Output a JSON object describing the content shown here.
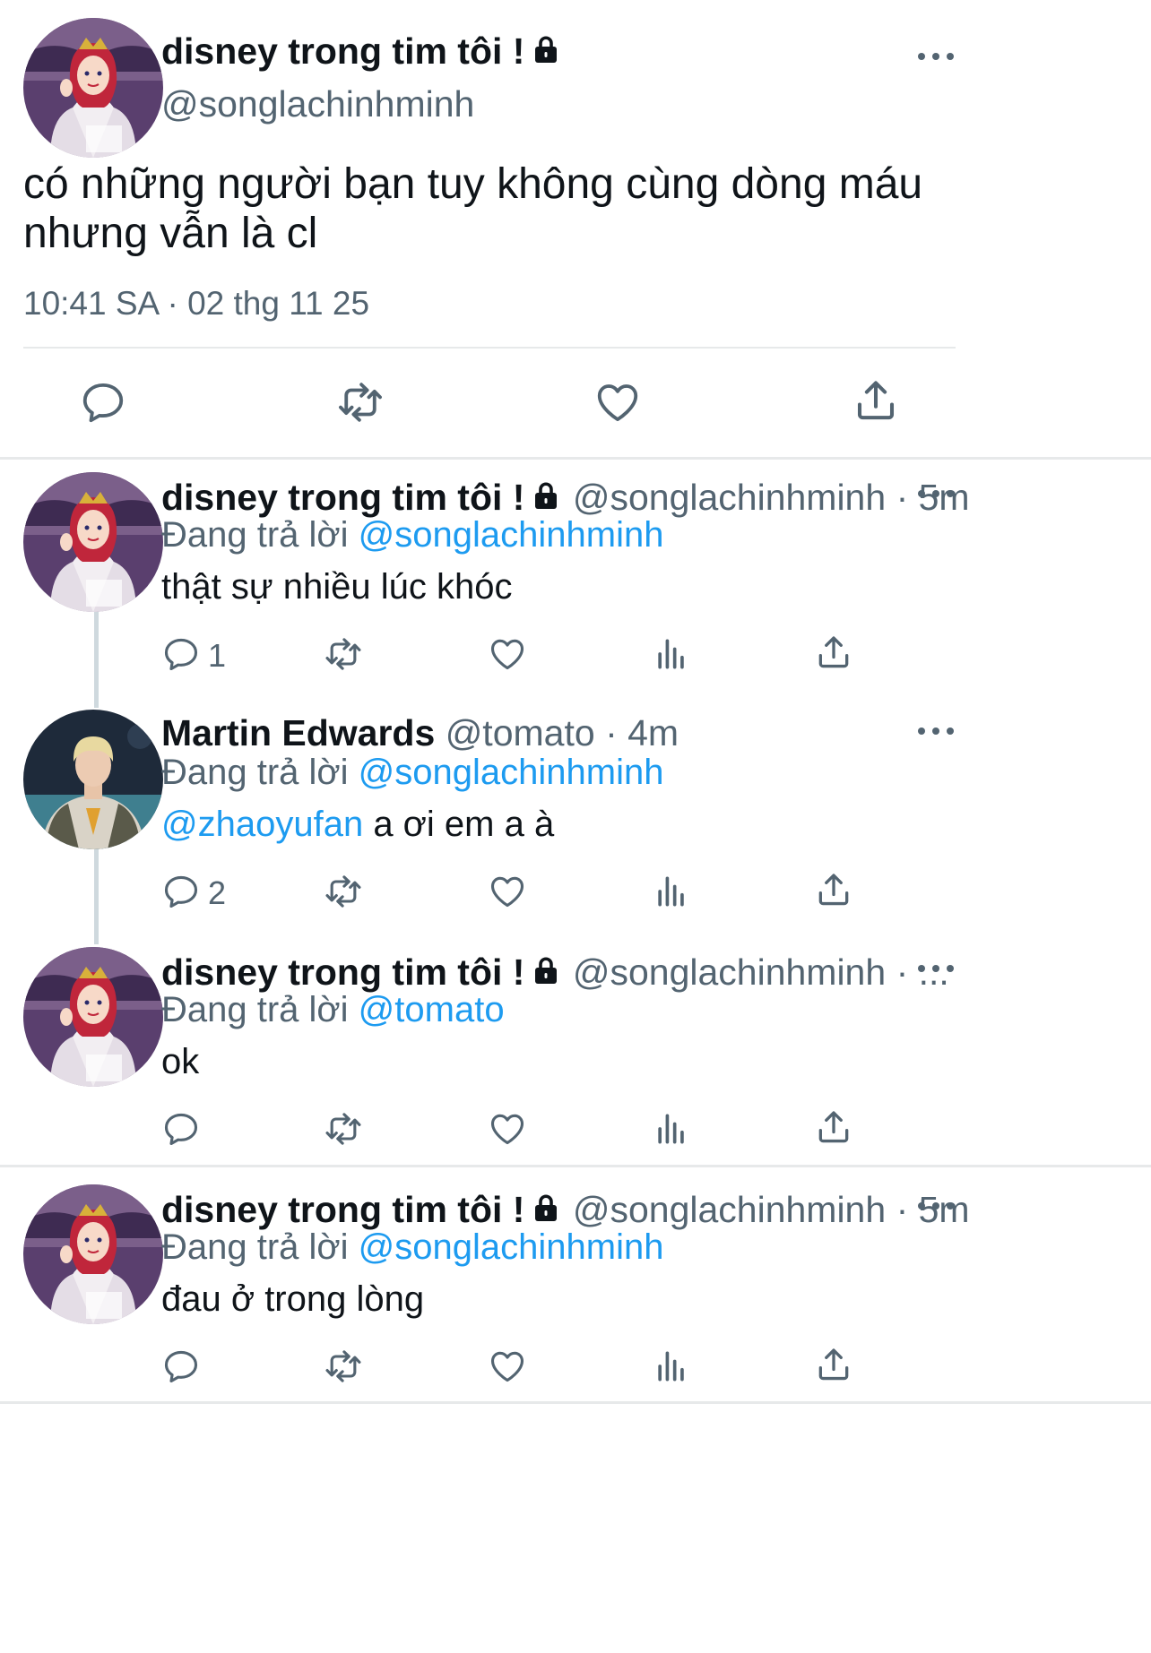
{
  "main_tweet": {
    "display_name": "disney trong tim tôi !",
    "handle": "@songlachinhminh",
    "text_line1": "có những người bạn tuy không cùng dòng máu",
    "text_line2": "nhưng vẫn là cl",
    "timestamp": "10:41 SA · 02 thg 11 25"
  },
  "replies": [
    {
      "display_name": "disney trong tim tôi !",
      "handle": "@songlachinhminh",
      "time": "· 5m",
      "replying_label": "Đang trả lời",
      "replying_to": "@songlachinhminh",
      "mention": "",
      "text": "thật sự nhiều lúc khóc",
      "reply_count": "1"
    },
    {
      "display_name": "Martin Edwards",
      "handle": "@tomato",
      "time": "· 4m",
      "replying_label": "Đang trả lời",
      "replying_to": "@songlachinhminh",
      "mention": "@zhaoyufan",
      "text": " a ơi em a à",
      "reply_count": "2"
    },
    {
      "display_name": "disney trong tim tôi !",
      "handle": "@songlachinhminh",
      "time": "· ...",
      "replying_label": "Đang trả lời",
      "replying_to": "@tomato",
      "mention": "",
      "text": "ok",
      "reply_count": ""
    },
    {
      "display_name": "disney trong tim tôi !",
      "handle": "@songlachinhminh",
      "time": "· 5m",
      "replying_label": "Đang trả lời",
      "replying_to": "@songlachinhminh",
      "mention": "",
      "text": "đau ở trong lòng",
      "reply_count": ""
    }
  ],
  "icons": {
    "reply": "reply-icon",
    "retweet": "retweet-icon",
    "like": "heart-icon",
    "analytics": "analytics-icon",
    "share": "share-icon",
    "more": "more-icon",
    "lock": "lock-icon"
  },
  "colors": {
    "link": "#1d9bf0",
    "secondary_text": "#536471",
    "primary_text": "#0f1419",
    "divider": "#e7e9ea"
  }
}
